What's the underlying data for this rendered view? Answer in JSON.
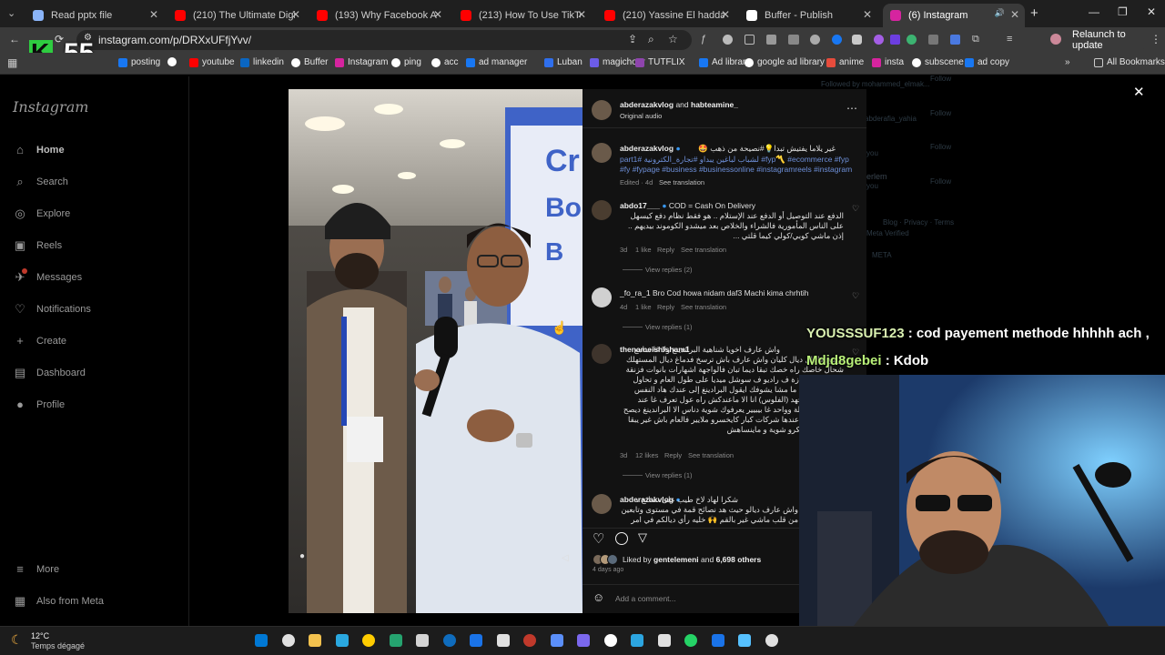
{
  "browser": {
    "tabs": [
      {
        "title": "Read pptx file",
        "fav": "#8ab4f8",
        "active": false
      },
      {
        "title": "(210) The Ultimate Digital Ma",
        "fav": "#ff0000",
        "active": false
      },
      {
        "title": "(193) Why Facebook Ads Are",
        "fav": "#ff0000",
        "active": false
      },
      {
        "title": "(213) How To Use TikTok LIVE",
        "fav": "#ff0000",
        "active": false
      },
      {
        "title": "(210) Yassine El haddadi | Ma",
        "fav": "#ff0000",
        "active": false
      },
      {
        "title": "Buffer - Publish",
        "fav": "#ffffff",
        "active": false
      },
      {
        "title": "(6) Instagram",
        "fav": "#d6249f",
        "active": true
      }
    ],
    "new_tab_label": "+",
    "window_controls": {
      "minimize": "—",
      "restore": "❐",
      "close": "✕"
    },
    "url": "instagram.com/p/DRXxUFfjYvv/",
    "relaunch_label": "Relaunch to update",
    "relaunch_color": "#3a3a3a",
    "overlay_badge": "55",
    "bookmarks": [
      {
        "label": "posting",
        "fav": "#1877f2"
      },
      {
        "label": "",
        "fav": "#ffffff"
      },
      {
        "label": "youtube",
        "fav": "#ff0000"
      },
      {
        "label": "linkedin",
        "fav": "#0a66c2"
      },
      {
        "label": "Buffer",
        "fav": "#ffffff"
      },
      {
        "label": "Instagram",
        "fav": "#d6249f"
      },
      {
        "label": "ping",
        "fav": "#ffffff"
      },
      {
        "label": "acc",
        "fav": "#ffffff"
      },
      {
        "label": "ad manager",
        "fav": "#1877f2"
      },
      {
        "label": "Luban",
        "fav": "#2f6fed"
      },
      {
        "label": "magichour",
        "fav": "#6c5ce7"
      },
      {
        "label": "TUTFLIX",
        "fav": "#8e44ad"
      },
      {
        "label": "Ad library",
        "fav": "#1877f2"
      },
      {
        "label": "google ad library",
        "fav": "#ffffff"
      },
      {
        "label": "anime",
        "fav": "#e74c3c"
      },
      {
        "label": "insta",
        "fav": "#d6249f"
      },
      {
        "label": "subscene",
        "fav": "#ffffff"
      },
      {
        "label": "ad copy",
        "fav": "#1877f2"
      }
    ],
    "all_bookmarks": "All Bookmarks"
  },
  "instagram": {
    "logo": "Instagram",
    "nav": [
      {
        "label": "Home",
        "icon": "home-icon",
        "glyph": "⌂"
      },
      {
        "label": "Search",
        "icon": "search-icon",
        "glyph": "⌕"
      },
      {
        "label": "Explore",
        "icon": "compass-icon",
        "glyph": "◎"
      },
      {
        "label": "Reels",
        "icon": "reels-icon",
        "glyph": "▣"
      },
      {
        "label": "Messages",
        "icon": "messenger-icon",
        "glyph": "✈"
      },
      {
        "label": "Notifications",
        "icon": "heart-icon",
        "glyph": "♡"
      },
      {
        "label": "Create",
        "icon": "plus-icon",
        "glyph": "+"
      },
      {
        "label": "Dashboard",
        "icon": "dashboard-icon",
        "glyph": "▤"
      },
      {
        "label": "Profile",
        "icon": "profile-icon",
        "glyph": "●"
      }
    ],
    "more": "More",
    "also_from_meta": "Also from Meta",
    "post": {
      "header_user": "abderazakvlog",
      "header_and": "and",
      "header_collab": "habteamine_",
      "header_audio": "Original audio",
      "caption": {
        "user": "abderazakvlog",
        "arabic_line1": "غير يلاما يفتيش تبدا💡#نصيحة من ذهب 🤩",
        "line2": "part1# لشباب لباغين يبداو #تجارة_الكترونية #fyp〽️ #ecommerce #fyp",
        "line3": "#fy #fypage #business #businessonline #instagramreels #instagram",
        "meta": "Edited · 4d",
        "see_translation": "See translation"
      },
      "comments": [
        {
          "user": "abdo17___",
          "text_lead": "COD = Cash On Delivery",
          "text_ar": "الدفع عند التوصيل أو الدفع عند الإستلام .. هو فقط نظام دفع كيسهل على الناس المأمورية فالشراء والخلاص بعد ميشدو الكوموند بيديهم .. إذن ماشي كوبي/كولي كيما قلتي ...",
          "age": "3d",
          "likes": "1 like",
          "reply": "Reply",
          "see_translation": "See translation",
          "view_replies": "View replies (2)"
        },
        {
          "user": "_fo_ra_1",
          "text": "Bro Cod howa nidam daf3 Machi kima chrhtih",
          "age": "4d",
          "likes": "1 like",
          "reply": "Reply",
          "see_translation": "See translation",
          "view_replies": "View replies (1)"
        },
        {
          "user": "thenameishisham1",
          "text_ar": "واش عارف اخويا شناهية البراندينغ ولا غا سامع ترسخ فالبال ديال كليان واش عارف باش ترسخ فدماغ ديال المستهلك شحال خاصك راه خصك تبقا ديما تبان فالواجهة اشهارات بانوات فزنقة اشهارات فتلفازة ف راديو ف سوشل ميديا على طول العام و تحاول المستهلك فين ما مشا يشوفك ايقول البرادينغ إلى عندك هاد النفس طويل وهاد الجهد (الفلوس) انا الا ماعندكش راه عول تعرف غا عند صحابك و العائلة وواحد غا بيبيير يعرفوك شوية دناس الا البراندينغ ديصح راه ماشي لي عندها شركات كبار كايخسرو ملايير فالعام باش غير يبقا المستهلك متفكرو شوية و ماينساهش",
          "age": "3d",
          "likes": "12 likes",
          "reply": "Reply",
          "see_translation": "See translation",
          "view_replies": "View replies (1)"
        },
        {
          "user": "abderazakvlog",
          "text_ar": "شكرا لهاد لاخ طيب على نصائح ، واش عارف ديالو حيث هد نصائح قمة في مستوى وتابعين من قلب ماشي غير بالقم 🙌 خليه رأي ديالكم في امر كيف جاتكم"
        }
      ],
      "liked_by_prefix": "Liked by",
      "liked_by_user": "gentelemeni",
      "liked_by_and": "and",
      "liked_by_count": "6,698 others",
      "posted_ago": "4 days ago",
      "add_comment_placeholder": "Add a comment..."
    },
    "dim_bg": {
      "followed_by": "Followed by mohammed_elmak...",
      "follow": "Follow",
      "user_fragment": "abderafia_yahia",
      "you": "you",
      "erlem": "erlem",
      "footer": "Blog · Privacy · Terms",
      "verified": "Meta Verified",
      "meta": "META"
    }
  },
  "stream_overlay": {
    "chat1_user": "YOUSSSUF123",
    "chat1_text": ": cod payement methode hhhhh ach ,",
    "chat1_color": "#d9f0b0",
    "chat2_user": "Mdjd8gebei",
    "chat2_text": ": Kdob",
    "chat2_color": "#b8f078"
  },
  "taskbar": {
    "weather_temp": "12°C",
    "weather_desc": "Temps dégagé",
    "apps": [
      "#0078d4",
      "#e0e0e0",
      "#f2c14e",
      "#2aa8e0",
      "#ffcc00",
      "#25a36f",
      "#d4d4d4",
      "#0f6cbd",
      "#1a73e8",
      "#e0e0e0",
      "#c0392b",
      "#5b8ff9",
      "#7b68ee",
      "#ffffff",
      "#2ca5e0",
      "#e0e0e0",
      "#25d366",
      "#1a73e8",
      "#56c1ff",
      "#e0e0e0"
    ]
  },
  "colors": {
    "ig_bg": "#000000",
    "panel_bg": "#121212",
    "hashtag": "#6d8fd8",
    "verified": "#3897f0"
  }
}
